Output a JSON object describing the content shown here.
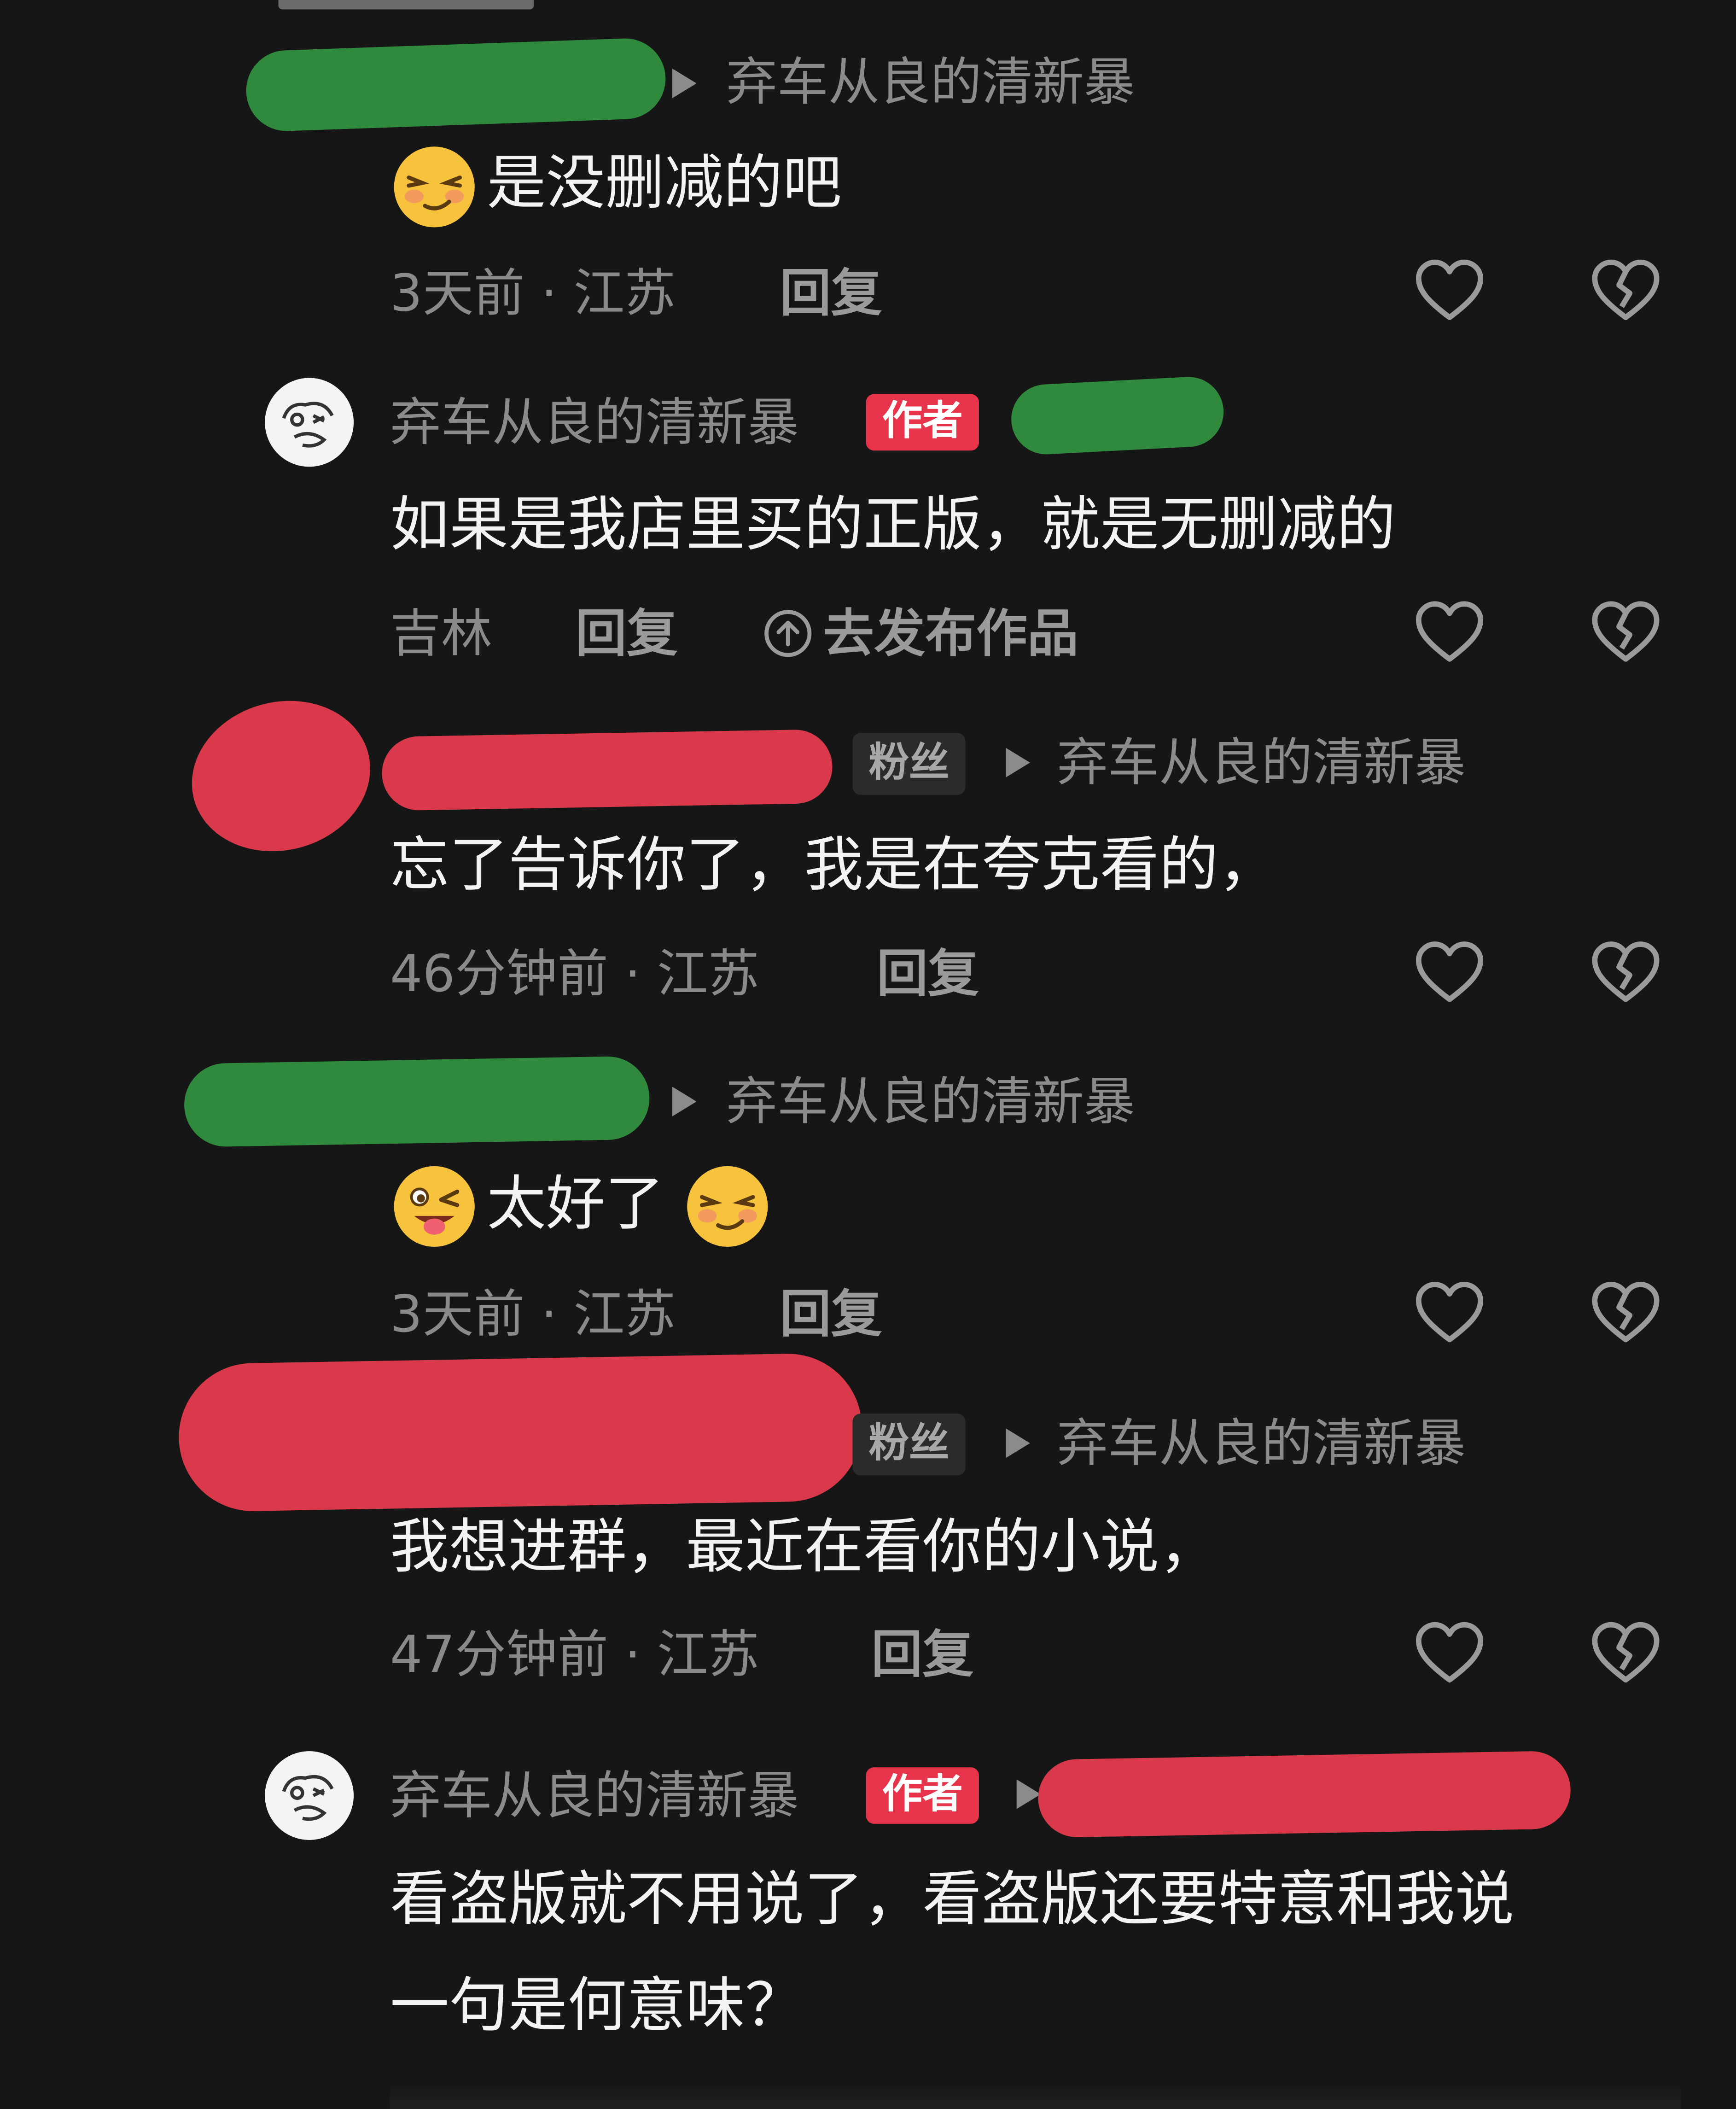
{
  "comments": [
    {
      "reply_to": "弃车从良的清新暴",
      "text": "是没删减的吧",
      "time": "3天前 · 江苏",
      "reply_label": "回复"
    },
    {
      "author": "弃车从良的清新暴",
      "author_badge": "作者",
      "text": "如果是我店里买的正版，就是无删减的",
      "location": "吉林",
      "reply_label": "回复",
      "publish_label": "去发布作品"
    },
    {
      "fan_badge": "粉丝",
      "reply_to": "弃车从良的清新暴",
      "text": "忘了告诉你了，我是在夸克看的，",
      "time": "46分钟前 · 江苏",
      "reply_label": "回复"
    },
    {
      "reply_to": "弃车从良的清新暴",
      "text": "太好了",
      "time": "3天前 · 江苏",
      "reply_label": "回复"
    },
    {
      "fan_badge": "粉丝",
      "reply_to": "弃车从良的清新暴",
      "text": "我想进群，最近在看你的小说，",
      "time": "47分钟前 · 江苏",
      "reply_label": "回复"
    },
    {
      "author": "弃车从良的清新暴",
      "author_badge": "作者",
      "text_line1": "看盗版就不用说了，看盗版还要特意和我说",
      "text_line2": "一句是何意味？"
    }
  ],
  "colors": {
    "background": "#161616",
    "author_badge": "#e8344a",
    "redaction_green": "#2f8a3e",
    "redaction_red": "#d9394b"
  },
  "icons": [
    "heart-outline-icon",
    "broken-heart-icon",
    "upload-circle-icon",
    "smirk-emoji",
    "wink-tongue-emoji"
  ]
}
